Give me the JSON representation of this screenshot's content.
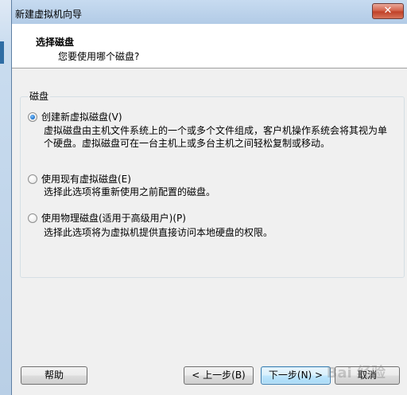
{
  "window": {
    "title": "新建虚拟机向导",
    "close_glyph": "✕"
  },
  "header": {
    "title": "选择磁盘",
    "subtitle": "您要使用哪个磁盘?"
  },
  "group": {
    "label": "磁盘"
  },
  "options": [
    {
      "label": "创建新虚拟磁盘(V)",
      "selected": true,
      "desc_line1": "虚拟磁盘由主机文件系统上的一个或多个文件组成，客户机操作系统会将其视为单",
      "desc_line2": "个硬盘。虚拟磁盘可在一台主机上或多台主机之间轻松复制或移动。"
    },
    {
      "label": "使用现有虚拟磁盘(E)",
      "selected": false,
      "desc_line1": "选择此选项将重新使用之前配置的磁盘。"
    },
    {
      "label": "使用物理磁盘(适用于高级用户)(P)",
      "selected": false,
      "desc_line1": "选择此选项将为虚拟机提供直接访问本地硬盘的权限。"
    }
  ],
  "buttons": {
    "help": "帮助",
    "back": "< 上一步(B)",
    "next": "下一步(N) >",
    "cancel": "取消"
  },
  "watermark": "Bai 经验"
}
